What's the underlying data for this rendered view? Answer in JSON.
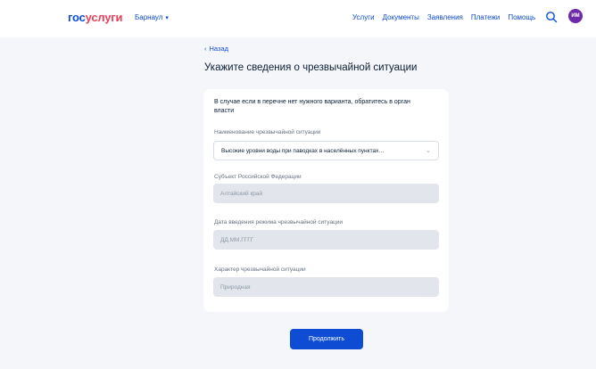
{
  "header": {
    "logo_part1": "гос",
    "logo_part2": "услуги",
    "region": "Барнаул",
    "nav": [
      "Услуги",
      "Документы",
      "Заявления",
      "Платежи",
      "Помощь"
    ],
    "avatar_initials": "ИМ"
  },
  "page": {
    "back_label": "Назад",
    "title": "Укажите сведения о чрезвычайной ситуации"
  },
  "form": {
    "intro": "В случае если в перечне нет нужного варианта, обратитесь в орган власти",
    "fields": [
      {
        "label": "Наименование чрезвычайной ситуации",
        "value": "Высокие уровни воды при паводках в населённых пунктах…"
      },
      {
        "label": "Субъект Российской Федерации",
        "placeholder": "Алтайский край"
      },
      {
        "label": "Дата введения режима чрезвычайной ситуации",
        "placeholder": "ДД.ММ.ГГГГ"
      },
      {
        "label": "Характер чрезвычайной ситуации",
        "placeholder": "Природная"
      }
    ]
  },
  "actions": {
    "continue_label": "Продолжить"
  },
  "colors": {
    "brand_blue": "#0d4cd3",
    "brand_red": "#ee3f58",
    "avatar": "#6d2aa8",
    "disabled_field": "#e2e6ec"
  }
}
